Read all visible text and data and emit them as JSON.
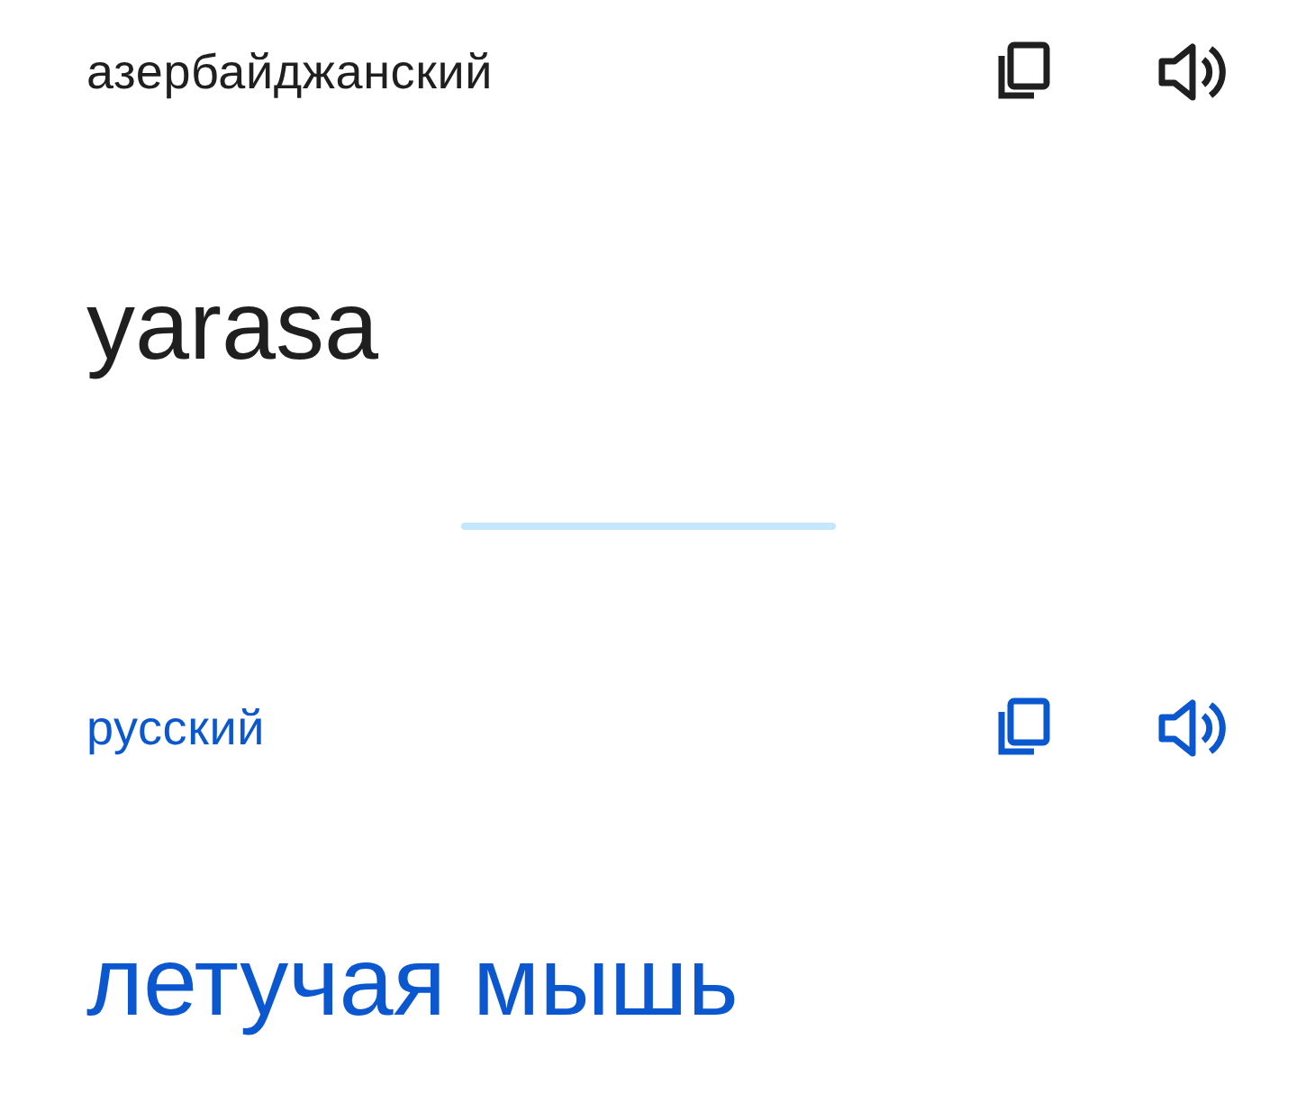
{
  "panels": [
    {
      "kind": "source",
      "language": "азербайджанский",
      "text": "yarasa"
    },
    {
      "kind": "target",
      "language": "русский",
      "text": "летучая мышь"
    }
  ]
}
